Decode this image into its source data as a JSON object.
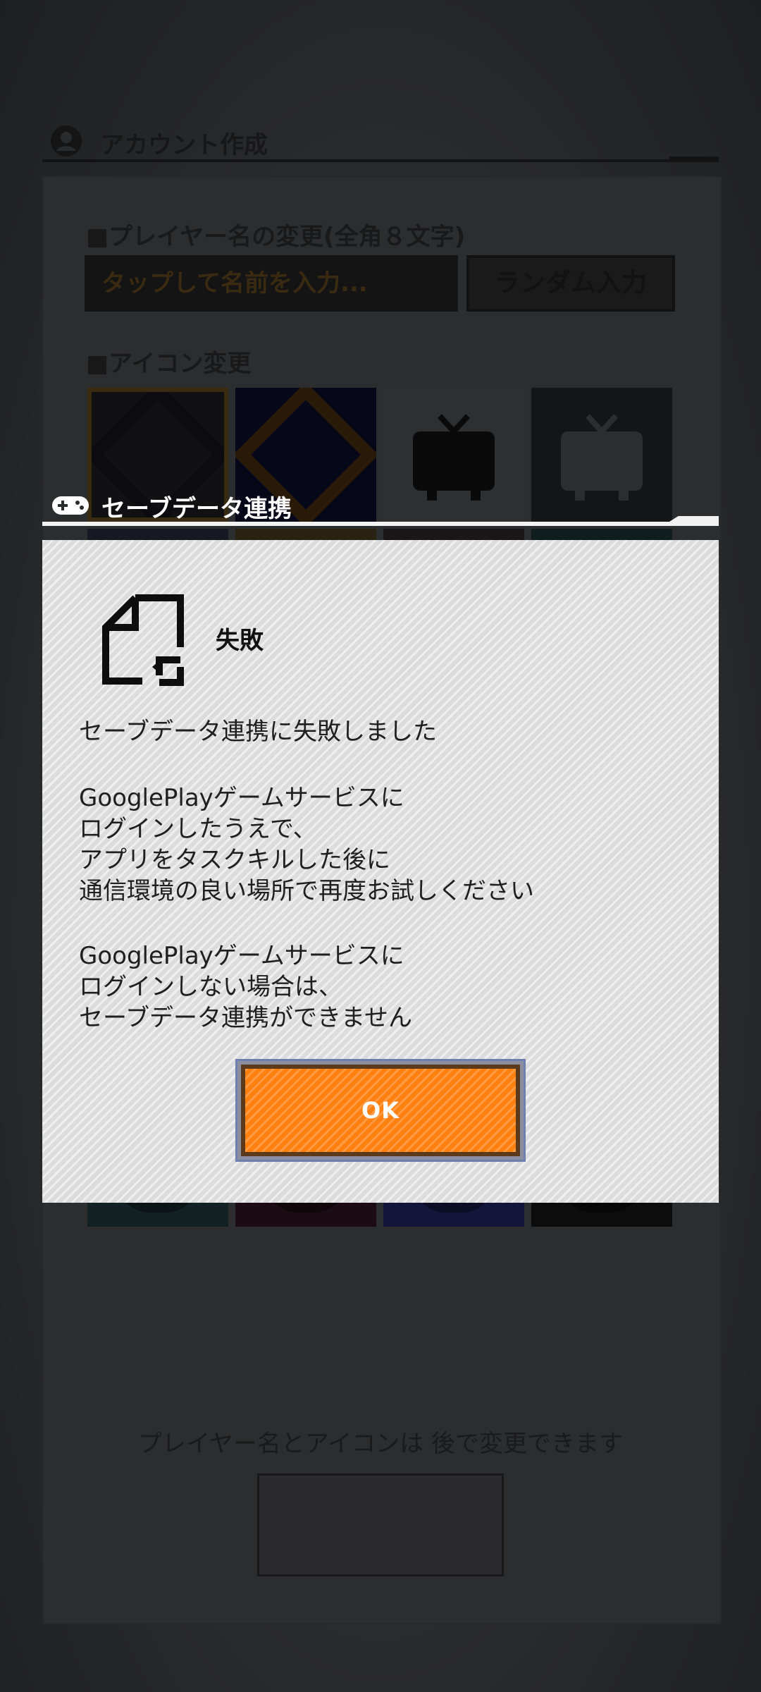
{
  "account_screen": {
    "section_title": "アカウント作成",
    "section_icon": "user-circle-icon",
    "name_label": "■プレイヤー名の変更(全角８文字)",
    "name_placeholder": "タップして名前を入力...",
    "random_button": "ランダム入力",
    "icon_label": "■アイコン変更",
    "bottom_hint": "プレイヤー名とアイコンは 後で変更できます"
  },
  "dialog": {
    "section_title": "セーブデータ連携",
    "section_icon": "gamepad-icon",
    "status_icon": "file-sync-icon",
    "status_title": "失敗",
    "message_lines": [
      "セーブデータ連携に失敗しました",
      "GooglePlayゲームサービスに\nログインしたうえで、\nアプリをタスクキルした後に\n通信環境の良い場所で再度お試しください",
      "GooglePlayゲームサービスに\nログインしない場合は、\nセーブデータ連携ができません"
    ],
    "ok_button": "OK",
    "ok_color": "#FF7F0F"
  }
}
